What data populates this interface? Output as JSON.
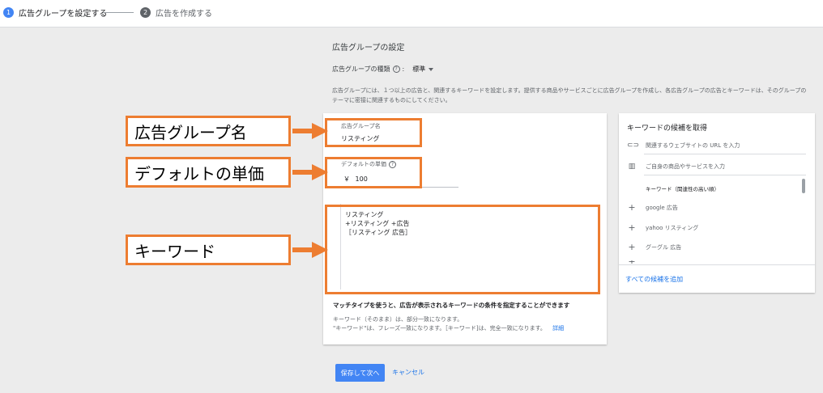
{
  "stepper": {
    "step1": {
      "num": "1",
      "label": "広告グループを設定する"
    },
    "step2": {
      "num": "2",
      "label": "広告を作成する"
    }
  },
  "settings": {
    "title": "広告グループの設定",
    "type_label": "広告グループの種類",
    "type_value": "標準",
    "description": "広告グループには、１つ以上の広告と、関連するキーワードを設定します。提供する商品やサービスごとに広告グループを作成し、各広告グループの広告とキーワードは、そのグループのテーマに密接に関連するものにしてください。"
  },
  "form": {
    "group_name_label": "広告グループ名",
    "group_name_value": "リスティング",
    "default_bid_label": "デフォルトの単価",
    "currency": "￥",
    "default_bid_value": "100",
    "keywords": [
      "リスティング",
      "+リスティング +広告",
      "［リスティング 広告］"
    ],
    "match_title": "マッチタイプを使うと、広告が表示されるキーワードの条件を指定することができます",
    "match_line1": "キーワード（そのまま）は、部分一致になります。",
    "match_line2": "\"キーワード\"は、フレーズ一致になります。［キーワード]は、完全一致になります。",
    "detail_link": "詳細"
  },
  "suggestions": {
    "title": "キーワードの候補を取得",
    "url_placeholder": "関連するウェブサイトの URL を入力",
    "product_placeholder": "ご自身の商品やサービスを入力",
    "list_header": "キーワード（関連性の高い順）",
    "items": [
      "google 広告",
      "yahoo リスティング",
      "グーグル 広告"
    ],
    "add_all": "すべての候補を追加"
  },
  "buttons": {
    "save": "保存して次へ",
    "cancel": "キャンセル"
  },
  "annotations": {
    "group_name": "広告グループ名",
    "default_bid": "デフォルトの単価",
    "keyword": "キーワード"
  },
  "colors": {
    "accent": "#4285f4",
    "annotation": "#ed7d31",
    "link": "#1a73e8"
  },
  "icons": [
    "help-icon",
    "link-icon",
    "building-icon",
    "plus-icon",
    "dropdown-caret-icon"
  ]
}
